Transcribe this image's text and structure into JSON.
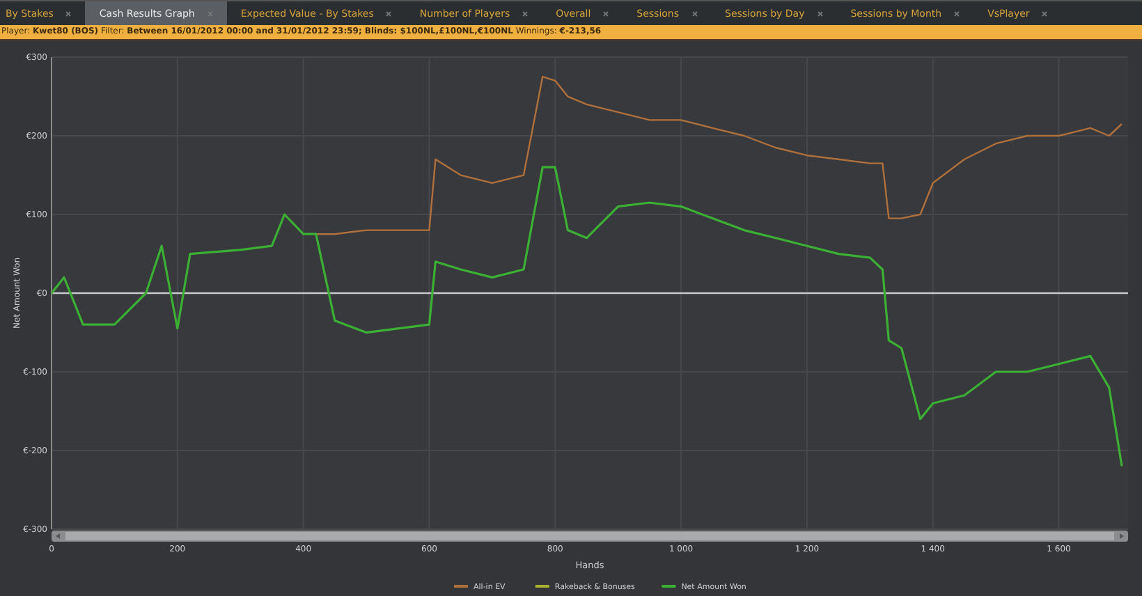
{
  "tabs": [
    {
      "label": "By Stakes",
      "selected": false
    },
    {
      "label": "Cash Results Graph",
      "selected": true
    },
    {
      "label": "Expected Value - By Stakes",
      "selected": false
    },
    {
      "label": "Number of Players",
      "selected": false
    },
    {
      "label": "Overall",
      "selected": false
    },
    {
      "label": "Sessions",
      "selected": false
    },
    {
      "label": "Sessions by Day",
      "selected": false
    },
    {
      "label": "Sessions by Month",
      "selected": false
    },
    {
      "label": "VsPlayer",
      "selected": false
    }
  ],
  "filter_bar": {
    "text": "Player: **Kwet80 (BOS)** Filter: **Between 16/01/2012 00:00 and 31/01/2012 23:59; Blinds: $100NL,£100NL,€100NL** Winnings: **€-213,56**"
  },
  "chart": {
    "chart_data": {
      "type": "line",
      "grid": true,
      "legend": true,
      "xlabel": "Hands",
      "ylabel": "Net Amount Won",
      "xlim": [
        0,
        1710
      ],
      "ylim": [
        -300,
        300
      ],
      "xticks": [
        0,
        200,
        400,
        600,
        800,
        {
          "value": 1000,
          "label": "1 000"
        },
        {
          "value": 1200,
          "label": "1 200"
        },
        {
          "value": 1400,
          "label": "1 400"
        },
        {
          "value": 1600,
          "label": "1 600"
        }
      ],
      "yticks": [
        {
          "value": -300,
          "label": "€-300"
        },
        {
          "value": -200,
          "label": "€-200"
        },
        {
          "value": -100,
          "label": "€-100"
        },
        {
          "value": 0,
          "label": "€0"
        },
        {
          "value": 100,
          "label": "€100"
        },
        {
          "value": 200,
          "label": "€200"
        },
        {
          "value": 300,
          "label": "€300"
        }
      ],
      "x": [
        0,
        20,
        50,
        100,
        150,
        175,
        200,
        220,
        300,
        350,
        370,
        400,
        420,
        450,
        500,
        550,
        600,
        610,
        650,
        700,
        750,
        780,
        800,
        820,
        850,
        900,
        950,
        1000,
        1050,
        1100,
        1150,
        1200,
        1250,
        1300,
        1320,
        1330,
        1350,
        1380,
        1400,
        1450,
        1500,
        1550,
        1600,
        1650,
        1680,
        1700
      ],
      "series": [
        {
          "name": "All-in EV",
          "color": "#b0703c",
          "values": [
            null,
            null,
            null,
            null,
            null,
            null,
            null,
            null,
            null,
            null,
            null,
            null,
            75,
            75,
            80,
            80,
            80,
            170,
            150,
            140,
            150,
            275,
            270,
            250,
            240,
            230,
            220,
            220,
            210,
            200,
            185,
            175,
            170,
            165,
            165,
            95,
            95,
            100,
            140,
            170,
            190,
            200,
            200,
            210,
            200,
            215
          ]
        },
        {
          "name": "Rakeback & Bonuses",
          "color": "#a8b030",
          "values": [
            null,
            null,
            null,
            null,
            null,
            null,
            null,
            null,
            null,
            null,
            null,
            null,
            null,
            null,
            null,
            null,
            null,
            null,
            null,
            null,
            null,
            null,
            null,
            null,
            null,
            null,
            null,
            null,
            null,
            null,
            null,
            null,
            null,
            null,
            null,
            null,
            null,
            null,
            null,
            null,
            null,
            null,
            null,
            null,
            null,
            null
          ]
        },
        {
          "name": "Net Amount Won",
          "color": "#3cb034",
          "values": [
            0,
            20,
            -40,
            -40,
            0,
            60,
            -45,
            50,
            55,
            60,
            100,
            75,
            75,
            -35,
            -50,
            -45,
            -40,
            40,
            30,
            20,
            30,
            160,
            160,
            80,
            70,
            110,
            115,
            110,
            95,
            80,
            70,
            60,
            50,
            45,
            30,
            -60,
            -70,
            -160,
            -140,
            -130,
            -100,
            -100,
            -90,
            -80,
            -120,
            -220
          ]
        }
      ]
    }
  }
}
